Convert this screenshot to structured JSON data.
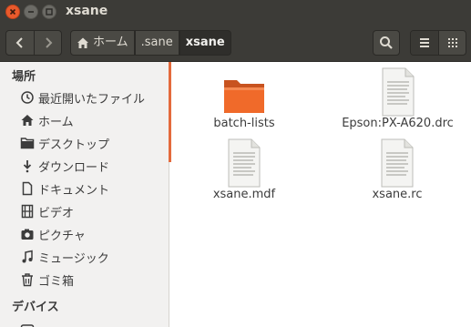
{
  "window": {
    "title": "xsane"
  },
  "breadcrumb": [
    {
      "label": "ホーム",
      "icon": "home-icon"
    },
    {
      "label": ".sane"
    },
    {
      "label": "xsane"
    }
  ],
  "sidebar": {
    "sections": [
      {
        "title": "場所"
      },
      {
        "title": "デバイス"
      }
    ],
    "items": [
      {
        "label": "最近開いたファイル",
        "icon": "clock-icon"
      },
      {
        "label": "ホーム",
        "icon": "home-icon"
      },
      {
        "label": "デスクトップ",
        "icon": "folder-icon"
      },
      {
        "label": "ダウンロード",
        "icon": "download-icon"
      },
      {
        "label": "ドキュメント",
        "icon": "document-icon"
      },
      {
        "label": "ビデオ",
        "icon": "film-icon"
      },
      {
        "label": "ピクチャ",
        "icon": "camera-icon"
      },
      {
        "label": "ミュージック",
        "icon": "music-icon"
      },
      {
        "label": "ゴミ箱",
        "icon": "trash-icon"
      }
    ]
  },
  "files": [
    {
      "name": "batch-lists",
      "type": "folder"
    },
    {
      "name": "Epson:PX-A620.drc",
      "type": "document"
    },
    {
      "name": "xsane.mdf",
      "type": "document"
    },
    {
      "name": "xsane.rc",
      "type": "document"
    }
  ],
  "colors": {
    "accent": "#e46a3c",
    "titlebar": "#3c3b37",
    "folder": "#f06a2a"
  }
}
